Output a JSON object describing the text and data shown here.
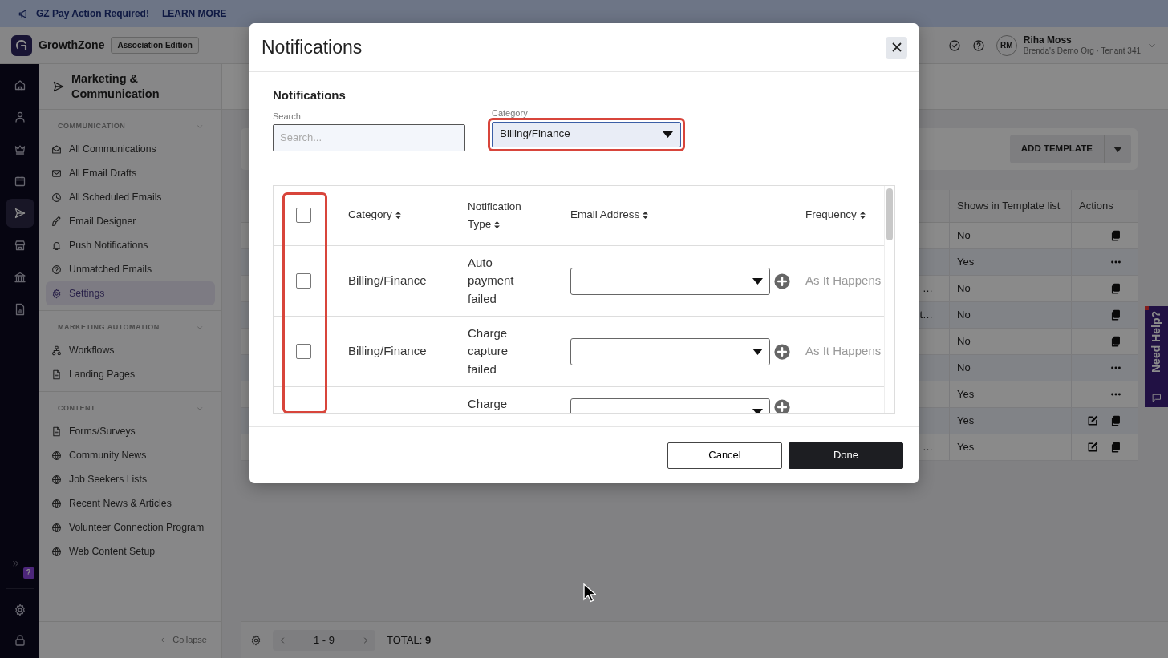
{
  "banner": {
    "title": "GZ Pay Action Required!",
    "link": "LEARN MORE"
  },
  "header": {
    "brand": "GrowthZone",
    "edition": "Association Edition",
    "user": {
      "initials": "RM",
      "name": "Riha Moss",
      "org": "Brenda's Demo Org · Tenant 341"
    }
  },
  "rail": {
    "items": [
      {
        "selected": false
      },
      {
        "selected": false
      },
      {
        "selected": false
      },
      {
        "selected": false
      },
      {
        "selected": true
      },
      {
        "selected": false
      },
      {
        "selected": false
      },
      {
        "selected": false
      }
    ],
    "help_badge": "?"
  },
  "sidebar": {
    "title": "Marketing & Communication",
    "sections": [
      {
        "heading": "COMMUNICATION",
        "expanded": true,
        "items": [
          {
            "label": "All Communications",
            "selected": false
          },
          {
            "label": "All Email Drafts",
            "selected": false
          },
          {
            "label": "All Scheduled Emails",
            "selected": false
          },
          {
            "label": "Email Designer",
            "selected": false
          },
          {
            "label": "Push Notifications",
            "selected": false
          },
          {
            "label": "Unmatched Emails",
            "selected": false
          },
          {
            "label": "Settings",
            "selected": true
          }
        ]
      },
      {
        "heading": "MARKETING AUTOMATION",
        "expanded": true,
        "items": [
          {
            "label": "Workflows",
            "selected": false
          },
          {
            "label": "Landing Pages",
            "selected": false
          }
        ]
      },
      {
        "heading": "CONTENT",
        "expanded": true,
        "items": [
          {
            "label": "Forms/Surveys",
            "selected": false
          },
          {
            "label": "Community News",
            "selected": false
          },
          {
            "label": "Job Seekers Lists",
            "selected": false
          },
          {
            "label": "Recent News & Articles",
            "selected": false
          },
          {
            "label": "Volunteer Connection Program",
            "selected": false
          },
          {
            "label": "Web Content Setup",
            "selected": false
          }
        ]
      }
    ],
    "collapse": "Collapse"
  },
  "page": {
    "toolbar": {
      "button": "ADD TEMPLATE"
    },
    "table": {
      "columns": [
        {
          "label": "Shows in Template list"
        },
        {
          "label": "Actions"
        }
      ],
      "rows": [
        {
          "shows": "No",
          "actions": [
            {
              "kind": "copy"
            }
          ]
        },
        {
          "shows": "Yes",
          "actions": [
            {
              "kind": "more"
            }
          ]
        },
        {
          "column_1": "…",
          "shows": "No",
          "actions": [
            {
              "kind": "copy"
            }
          ]
        },
        {
          "column_1": "t…",
          "shows": "No",
          "actions": [
            {
              "kind": "copy"
            }
          ]
        },
        {
          "shows": "No",
          "actions": [
            {
              "kind": "copy"
            }
          ]
        },
        {
          "shows": "No",
          "actions": [
            {
              "kind": "more"
            }
          ]
        },
        {
          "shows": "Yes",
          "actions": [
            {
              "kind": "more"
            }
          ]
        },
        {
          "shows": "Yes",
          "actions": [
            {
              "kind": "edit"
            },
            {
              "kind": "copy"
            }
          ]
        },
        {
          "column_1": "…",
          "shows": "Yes",
          "actions": [
            {
              "kind": "edit"
            },
            {
              "kind": "copy"
            }
          ]
        }
      ]
    },
    "pagination": {
      "range": "1 - 9",
      "total": "TOTAL: **9**"
    }
  },
  "need_help": "Need Help?",
  "modal": {
    "title": "Notifications",
    "section_title": "Notifications",
    "search": {
      "label": "Search",
      "placeholder": "Search..."
    },
    "category": {
      "label": "Category",
      "value": "Billing/Finance",
      "highlighted": true
    },
    "table": {
      "select_all_checked": false,
      "checkbox_column_highlighted": true,
      "columns": [
        {
          "label": "Category"
        },
        {
          "label": "Notification Type"
        },
        {
          "label": "Email Address"
        },
        {
          "label": "Frequency"
        }
      ],
      "rows": [
        {
          "checked": false,
          "category": "Billing/Finance",
          "notification_type": "Auto payment failed",
          "frequency": "As It Happens"
        },
        {
          "checked": false,
          "category": "Billing/Finance",
          "notification_type": "Charge capture failed",
          "frequency": "As It Happens"
        },
        {
          "notification_type": "Charge"
        }
      ]
    },
    "buttons": [
      {
        "label": "Cancel",
        "kind": "secondary"
      },
      {
        "label": "Done",
        "kind": "primary"
      }
    ]
  }
}
